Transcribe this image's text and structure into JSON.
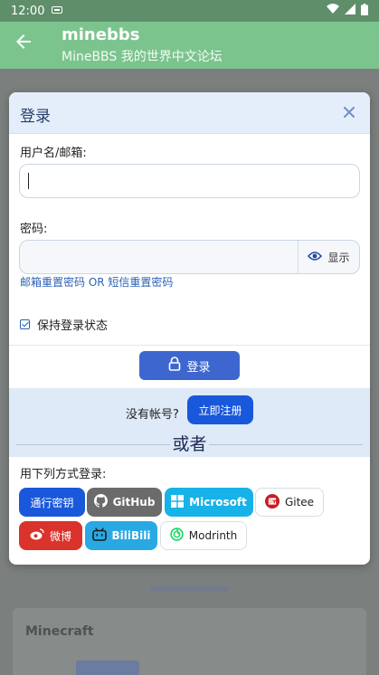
{
  "status_bar": {
    "time": "12:00",
    "notification_icon": "sim-icon",
    "wifi_icon": "wifi-icon",
    "signal_icon": "signal-icon",
    "battery_icon": "battery-icon"
  },
  "app_bar": {
    "back_icon": "arrow-back-icon",
    "title": "minebbs",
    "subtitle": "MineBBS 我的世界中文论坛"
  },
  "background": {
    "card_title": "Minecraft"
  },
  "modal": {
    "title": "登录",
    "close_icon": "close-icon",
    "username_label": "用户名/邮箱:",
    "username_value": "",
    "password_label": "密码:",
    "password_value": "",
    "show_password_label": "显示",
    "show_password_icon": "eye-icon",
    "reset_link": "邮箱重置密码 OR 短信重置密码",
    "remember_label": "保持登录状态",
    "remember_checked": true,
    "login_button": "登录",
    "login_icon": "lock-icon",
    "no_account_text": "没有帐号?",
    "register_button": "立即注册",
    "or_text": "或者",
    "third_party_label": "用下列方式登录:",
    "providers": [
      {
        "label": "通行密钥",
        "icon": "",
        "color": "#1a58db"
      },
      {
        "label": "GitHub",
        "icon": "github-icon",
        "color": "#6b6b6b"
      },
      {
        "label": "Microsoft",
        "icon": "windows-icon",
        "color": "#16b2e8"
      },
      {
        "label": "Gitee",
        "icon": "gitee-icon",
        "color": "#ffffff"
      },
      {
        "label": "微博",
        "icon": "weibo-icon",
        "color": "#d9332c"
      },
      {
        "label": "BiliBili",
        "icon": "bilibili-icon",
        "color": "#29a9e3"
      },
      {
        "label": "Modrinth",
        "icon": "modrinth-icon",
        "color": "#ffffff"
      }
    ]
  }
}
